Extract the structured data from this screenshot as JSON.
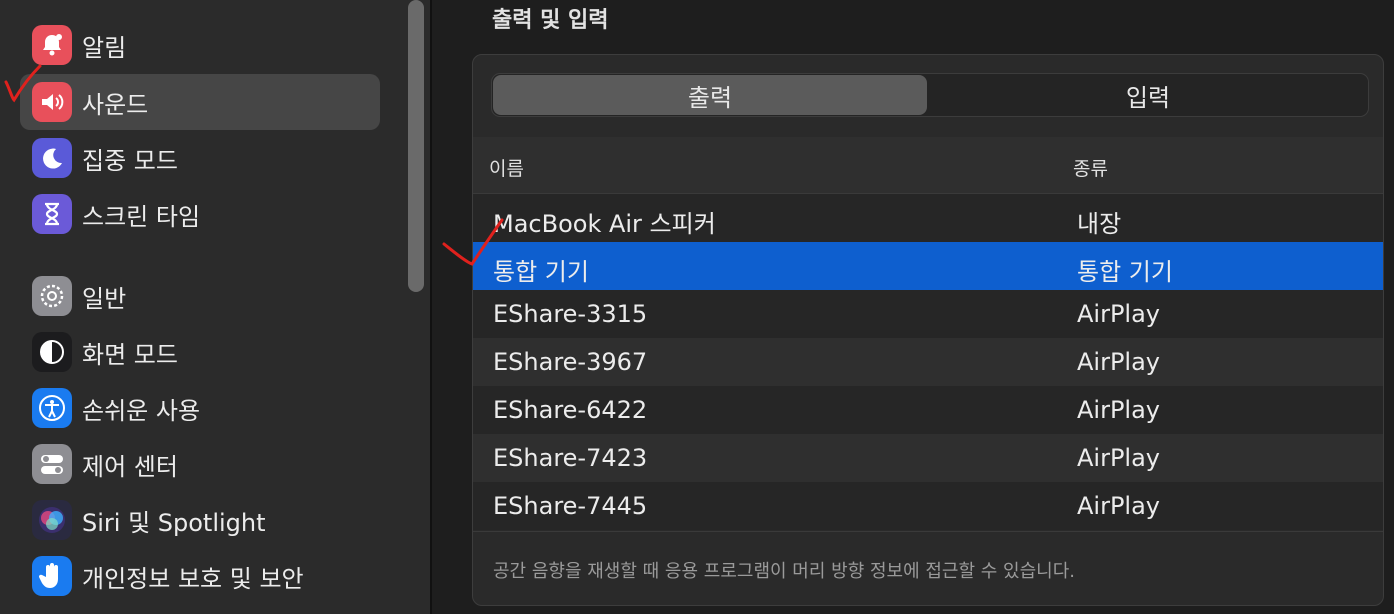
{
  "sidebar": {
    "items": [
      {
        "label": "알림",
        "icon": "bell-icon",
        "color": "#e8505b"
      },
      {
        "label": "사운드",
        "icon": "speaker-icon",
        "color": "#e8505b",
        "selected": true
      },
      {
        "label": "집중 모드",
        "icon": "moon-icon",
        "color": "#5a5ad8"
      },
      {
        "label": "스크린 타임",
        "icon": "hourglass-icon",
        "color": "#6b5ad8"
      },
      {
        "label": "일반",
        "icon": "gear-icon",
        "color": "#8e8e93"
      },
      {
        "label": "화면 모드",
        "icon": "appearance-icon",
        "color": "#1c1c1e"
      },
      {
        "label": "손쉬운 사용",
        "icon": "accessibility-icon",
        "color": "#1a7bf0"
      },
      {
        "label": "제어 센터",
        "icon": "control-center-icon",
        "color": "#8e8e93"
      },
      {
        "label": "Siri 및 Spotlight",
        "icon": "siri-icon",
        "color": "#2a2a40"
      },
      {
        "label": "개인정보 보호 및 보안",
        "icon": "hand-icon",
        "color": "#1a7bf0"
      }
    ]
  },
  "main": {
    "section_title": "출력 및 입력",
    "tabs": [
      {
        "label": "출력",
        "active": true
      },
      {
        "label": "입력",
        "active": false
      }
    ],
    "table": {
      "headers": [
        "이름",
        "종류"
      ],
      "rows": [
        {
          "name": "MacBook Air 스피커",
          "type": "내장"
        },
        {
          "name": "통합 기기",
          "type": "통합 기기",
          "selected": true
        },
        {
          "name": "EShare-3315",
          "type": "AirPlay"
        },
        {
          "name": "EShare-3967",
          "type": "AirPlay"
        },
        {
          "name": "EShare-6422",
          "type": "AirPlay"
        },
        {
          "name": "EShare-7423",
          "type": "AirPlay"
        },
        {
          "name": "EShare-7445",
          "type": "AirPlay"
        }
      ]
    },
    "footnote": "공간 음향을 재생할 때 응용 프로그램이 머리 방향 정보에 접근할 수 있습니다."
  },
  "colors": {
    "selection_blue": "#0e5fcf",
    "annotation_red": "#e0211d"
  }
}
